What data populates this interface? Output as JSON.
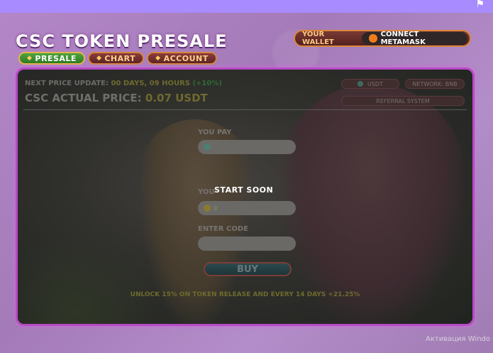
{
  "topbar": {
    "icon": "flag-icon"
  },
  "header": {
    "title": "CSC TOKEN PRESALE",
    "tabs": [
      {
        "label": "PRESALE",
        "active": true
      },
      {
        "label": "CHART",
        "active": false
      },
      {
        "label": "ACCOUNT",
        "active": false
      }
    ]
  },
  "wallet": {
    "label": "YOUR WALLET",
    "connect_label": "CONNECT METAMASK"
  },
  "panel": {
    "next_update_label": "NEXT PRICE UPDATE:",
    "next_update_value": "00 DAYS, 09 HOURS",
    "next_update_change": "(+10%)",
    "actual_price_label": "CSC ACTUAL PRICE:",
    "actual_price_value": "0.07 USDT",
    "token_chip": "USDT",
    "network_chip": "NETWORK: BNB",
    "referral_chip": "REFERRAL SYSTEM",
    "you_pay_label": "YOU PAY",
    "you_pay_value": "",
    "you_get_label": "YOU",
    "you_get_value": "0",
    "enter_code_label": "ENTER CODE",
    "enter_code_value": "",
    "start_soon": "START SOON",
    "buy_label": "BUY",
    "unlock_text": "UNLOCK 15% ON TOKEN RELEASE AND EVERY 14 DAYS +21.25%"
  },
  "os_overlay": {
    "activation_text": "Активация Windo"
  },
  "colors": {
    "accent_purple": "#a88cff",
    "panel_border": "#b54bc4",
    "active_tab": "#3e9630"
  }
}
